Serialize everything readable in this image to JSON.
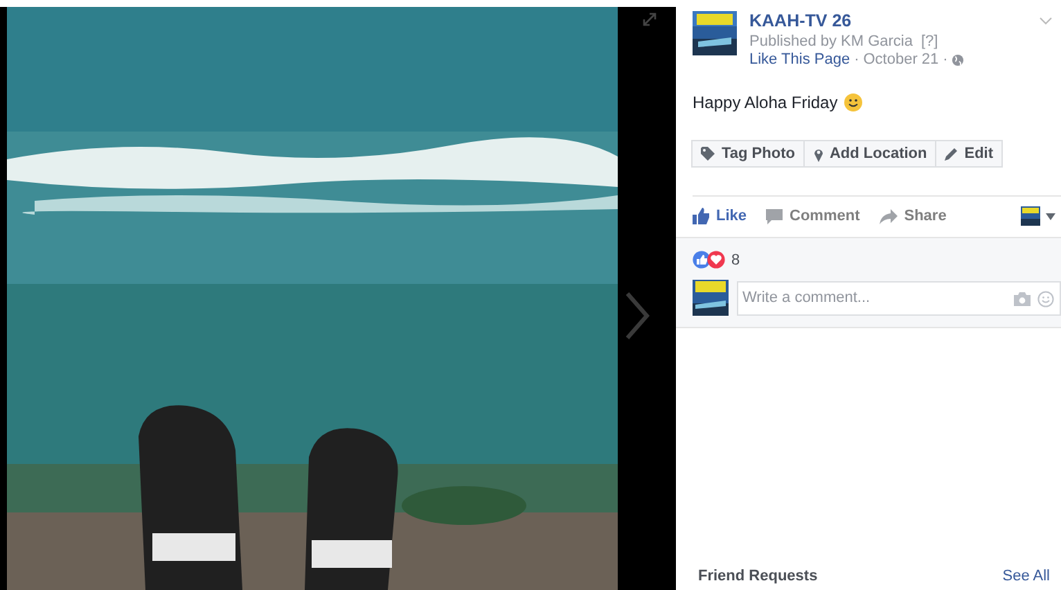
{
  "page": {
    "name": "KAAH-TV 26",
    "published_by": "Published by KM Garcia",
    "help_mark": "[?]",
    "like_page": "Like This Page",
    "date": "October 21",
    "separator": "·"
  },
  "post_text": "Happy Aloha Friday",
  "photo_actions": [
    {
      "kind": "tag",
      "label": "Tag Photo"
    },
    {
      "kind": "location",
      "label": "Add Location"
    },
    {
      "kind": "edit",
      "label": "Edit"
    }
  ],
  "actions": [
    {
      "kind": "like",
      "label": "Like",
      "selected": true
    },
    {
      "kind": "comment",
      "label": "Comment",
      "selected": false
    },
    {
      "kind": "share",
      "label": "Share",
      "selected": false
    }
  ],
  "reactions": {
    "count": "8"
  },
  "comment": {
    "placeholder": "Write a comment..."
  },
  "friend_requests": {
    "title": "Friend Requests",
    "link": "See All"
  }
}
